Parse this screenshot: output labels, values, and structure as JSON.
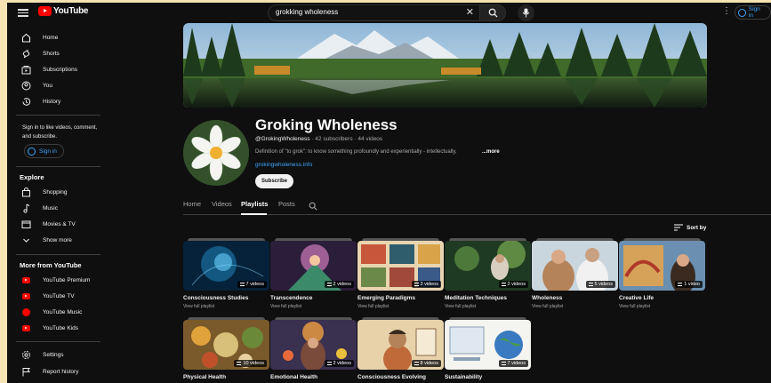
{
  "header": {
    "logo_text": "YouTube",
    "search_value": "grokking wholeness",
    "sign_in": "Sign in"
  },
  "sidebar": {
    "main": [
      {
        "label": "Home",
        "icon": "home-icon"
      },
      {
        "label": "Shorts",
        "icon": "shorts-icon"
      },
      {
        "label": "Subscriptions",
        "icon": "subscriptions-icon"
      },
      {
        "label": "You",
        "icon": "you-icon"
      },
      {
        "label": "History",
        "icon": "history-icon"
      }
    ],
    "signin_note": "Sign in to like videos, comment, and subscribe.",
    "signin_button": "Sign in",
    "explore_heading": "Explore",
    "explore": [
      {
        "label": "Shopping",
        "icon": "shopping-icon"
      },
      {
        "label": "Music",
        "icon": "music-icon"
      },
      {
        "label": "Movies & TV",
        "icon": "movies-icon"
      },
      {
        "label": "Show more",
        "icon": "chevron-down-icon"
      }
    ],
    "more_heading": "More from YouTube",
    "more": [
      {
        "label": "YouTube Premium",
        "icon": "youtube-premium-icon"
      },
      {
        "label": "YouTube TV",
        "icon": "youtube-tv-icon"
      },
      {
        "label": "YouTube Music",
        "icon": "youtube-music-icon"
      },
      {
        "label": "YouTube Kids",
        "icon": "youtube-kids-icon"
      }
    ],
    "bottom": [
      {
        "label": "Settings",
        "icon": "gear-icon"
      },
      {
        "label": "Report history",
        "icon": "flag-icon"
      }
    ]
  },
  "channel": {
    "title": "Groking Wholeness",
    "handle": "@GrokingWholeness",
    "stats": "· 42 subscribers · 44 videos",
    "description": "Definition of \"to grok\": to know something profoundly and experientially - intellectually,",
    "more_label": "...more",
    "link": "grokingwholeness.info",
    "subscribe": "Subscribe"
  },
  "tabs": [
    "Home",
    "Videos",
    "Playlists",
    "Posts"
  ],
  "active_tab": "Playlists",
  "sort_label": "Sort by",
  "playlists": [
    {
      "title": "Consciousness Studies",
      "count": "7 videos",
      "sub": "View full playlist"
    },
    {
      "title": "Transcendence",
      "count": "2 videos",
      "sub": "View full playlist"
    },
    {
      "title": "Emerging Paradigms",
      "count": "3 videos",
      "sub": "View full playlist"
    },
    {
      "title": "Meditation Techniques",
      "count": "2 videos",
      "sub": "View full playlist"
    },
    {
      "title": "Wholeness",
      "count": "5 videos",
      "sub": "View full playlist"
    },
    {
      "title": "Creative Life",
      "count": "1 video",
      "sub": "View full playlist"
    },
    {
      "title": "Physical Health",
      "count": "10 videos",
      "sub": ""
    },
    {
      "title": "Emotional Health",
      "count": "2 videos",
      "sub": ""
    },
    {
      "title": "Consciousness Evolving",
      "count": "8 videos",
      "sub": ""
    },
    {
      "title": "Sustainability",
      "count": "7 videos",
      "sub": ""
    }
  ],
  "colors": {
    "accent": "#3ea6ff",
    "brand": "#ff0000",
    "background": "#0f0f0f"
  }
}
